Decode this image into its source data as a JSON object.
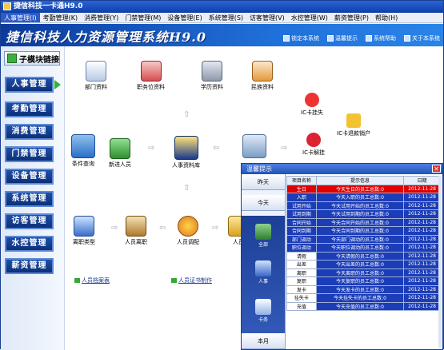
{
  "window": {
    "title": "捷信科技一卡通H9.0"
  },
  "menu": [
    "人事管理(I)",
    "考勤管理(K)",
    "消费管理(Y)",
    "门禁管理(M)",
    "设备管理(E)",
    "系统管理(S)",
    "访客管理(V)",
    "水控管理(W)",
    "薪资管理(P)",
    "帮助(H)"
  ],
  "banner": {
    "title": "捷信科技人力资源管理系统H9.0",
    "links": [
      "锁定本系统",
      "温馨提示",
      "系统帮助",
      "关于本系统"
    ]
  },
  "sidebar": {
    "header": "子模块链接",
    "items": [
      "人事管理",
      "考勤管理",
      "消费管理",
      "门禁管理",
      "设备管理",
      "系统管理",
      "访客管理",
      "水控管理",
      "薪资管理"
    ]
  },
  "flow": {
    "nodes": [
      "部门资料",
      "职务位资料",
      "学历资料",
      "民族资料",
      "IC卡挂失",
      "IC卡退款销户",
      "新进人员",
      "人事资料库",
      "IC卡解挂",
      "离职类型",
      "人员离职",
      "人员调配",
      "人员"
    ],
    "links": [
      "人员档案表",
      "人员证书制作"
    ],
    "search_label": "条件查询"
  },
  "dialog": {
    "title": "温馨提示",
    "tabs": [
      "昨天",
      "今天",
      "本月"
    ],
    "pane_items": [
      "全部",
      "人事",
      "卡务"
    ],
    "columns": [
      "项目名称",
      "提示信息",
      "日期"
    ],
    "rows": [
      {
        "name": "生日",
        "info": "今天生日的员工总数:0",
        "date": "2012-11-28",
        "style": "red"
      },
      {
        "name": "入职",
        "info": "今天入职的员工总数:0",
        "date": "2012-11-28",
        "style": "blue"
      },
      {
        "name": "试用开始",
        "info": "今天试用开始的员工总数:0",
        "date": "2012-11-28",
        "style": "blue"
      },
      {
        "name": "试用到期",
        "info": "今天试用到期的员工总数:0",
        "date": "2012-11-28",
        "style": "blue"
      },
      {
        "name": "合同开始",
        "info": "今天合同开始的员工总数:0",
        "date": "2012-11-28",
        "style": "blue"
      },
      {
        "name": "合同到期",
        "info": "今天合同到期的员工总数:0",
        "date": "2012-11-28",
        "style": "blue"
      },
      {
        "name": "部门调动",
        "info": "今天部门调动的员工总数:0",
        "date": "2012-11-28",
        "style": "blue"
      },
      {
        "name": "职位调动",
        "info": "今天职位调动的员工总数:0",
        "date": "2012-11-28",
        "style": "blue"
      },
      {
        "name": "请假",
        "info": "今天请假的员工总数:0",
        "date": "2012-11-28",
        "style": "white"
      },
      {
        "name": "出差",
        "info": "今天出差的员工总数:0",
        "date": "2012-11-28",
        "style": "white"
      },
      {
        "name": "离职",
        "info": "今天离职的员工总数:0",
        "date": "2012-11-28",
        "style": "white"
      },
      {
        "name": "复职",
        "info": "今天复职的员工总数:0",
        "date": "2012-11-28",
        "style": "white"
      },
      {
        "name": "发卡",
        "info": "今天发卡的员工总数:0",
        "date": "2012-11-28",
        "style": "white"
      },
      {
        "name": "挂失卡",
        "info": "今天挂失卡的员工总数:0",
        "date": "2012-11-28",
        "style": "white"
      },
      {
        "name": "充值",
        "info": "今天充值的员工总数:0",
        "date": "2012-11-28",
        "style": "white"
      }
    ]
  },
  "colors": {
    "accent": "#1c3db8",
    "highlight": "#e00000",
    "nav": "#0c2f78"
  }
}
